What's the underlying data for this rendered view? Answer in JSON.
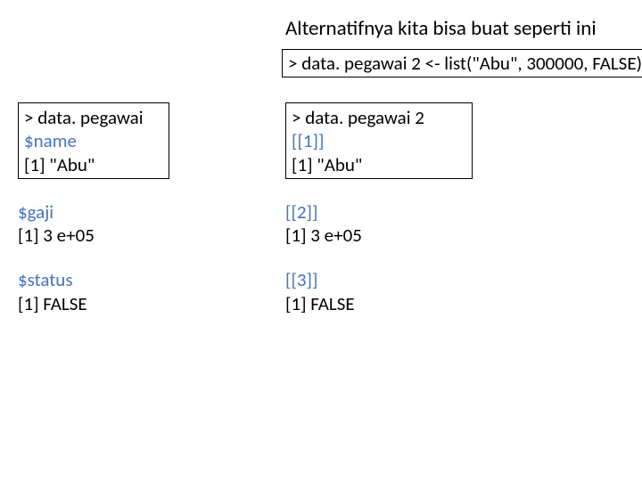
{
  "heading": "Alternatifnya kita bisa buat seperti ini",
  "code_line": "> data. pegawai 2 <- list(\"Abu\", 300000, FALSE)",
  "left": {
    "box_line1": "> data. pegawai",
    "box_line2": "$name",
    "box_line3": "[1] \"Abu\"",
    "b2_l1": "$gaji",
    "b2_l2": "[1] 3 e+05",
    "b3_l1": "$status",
    "b3_l2": "[1] FALSE"
  },
  "right": {
    "box_line1": "> data. pegawai 2",
    "box_line2": "[[1]]",
    "box_line3": "[1] \"Abu\"",
    "b2_l1": "[[2]]",
    "b2_l2": "[1] 3 e+05",
    "b3_l1": "[[3]]",
    "b3_l2": "[1] FALSE"
  }
}
